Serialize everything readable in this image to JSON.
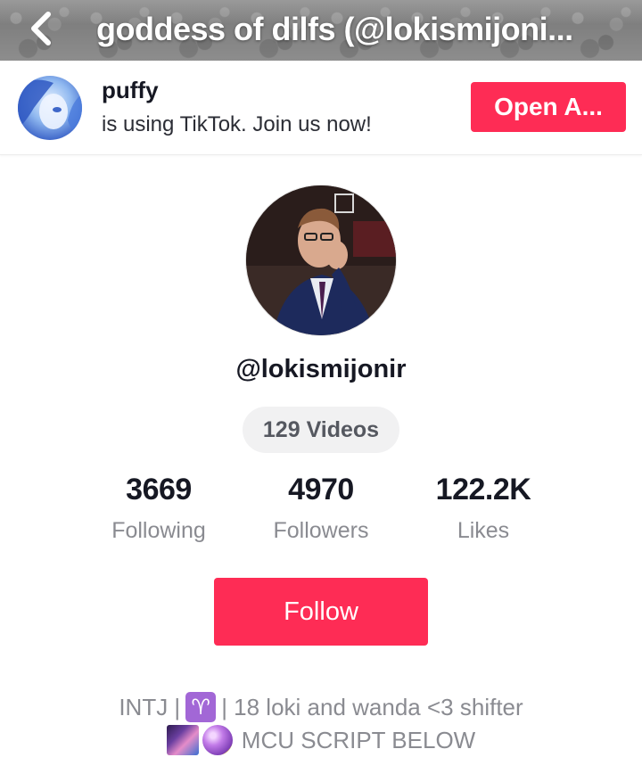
{
  "header": {
    "title": "goddess of dilfs (@lokismijoni...",
    "back_icon": "chevron-left-icon"
  },
  "banner": {
    "name": "puffy",
    "text": "is using TikTok. Join us now!",
    "open_app_label": "Open A..."
  },
  "profile": {
    "username": "@lokismijonir",
    "videos_label": "129 Videos",
    "stats": {
      "following": {
        "value": "3669",
        "label": "Following"
      },
      "followers": {
        "value": "4970",
        "label": "Followers"
      },
      "likes": {
        "value": "122.2K",
        "label": "Likes"
      }
    },
    "follow_label": "Follow",
    "bio": {
      "line1_a": "INTJ |",
      "line1_emoji": "♈",
      "line1_b": "| 18 loki and wanda <3 shifter",
      "line2": "MCU SCRIPT BELOW"
    }
  },
  "colors": {
    "accent": "#fe2c55",
    "text": "#161823",
    "muted": "#8a8b91"
  }
}
